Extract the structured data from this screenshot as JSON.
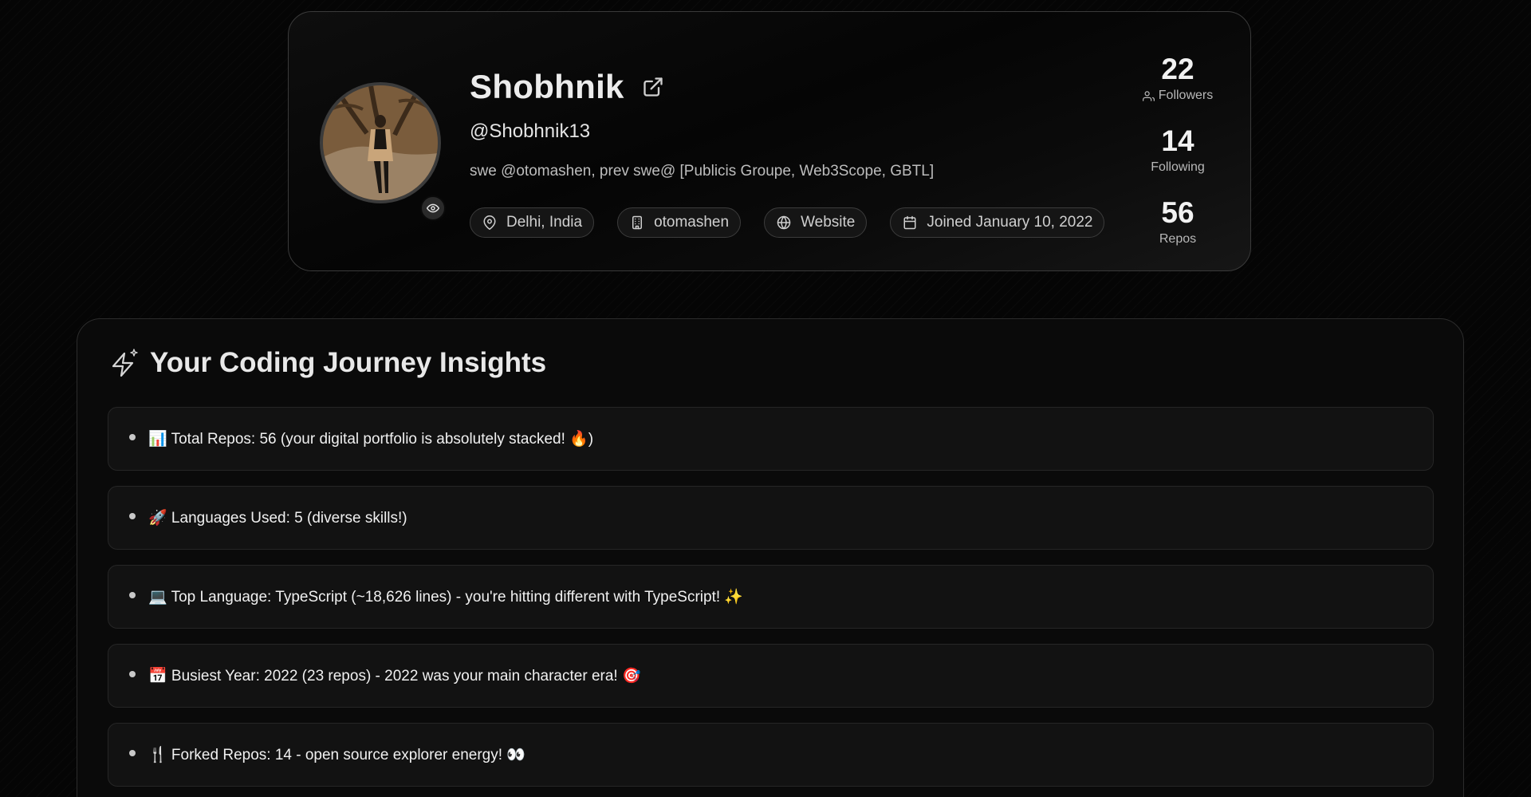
{
  "profile": {
    "name": "Shobhnik",
    "handle": "@Shobhnik13",
    "bio": "swe @otomashen, prev swe@ [Publicis Groupe, Web3Scope, GBTL]",
    "chips": [
      {
        "icon": "map-pin-icon",
        "label": "Delhi, India"
      },
      {
        "icon": "building-icon",
        "label": "otomashen"
      },
      {
        "icon": "globe-icon",
        "label": "Website"
      },
      {
        "icon": "calendar-icon",
        "label": "Joined January 10, 2022"
      }
    ],
    "stats": {
      "followers": {
        "value": "22",
        "label": "Followers"
      },
      "following": {
        "value": "14",
        "label": "Following"
      },
      "repos": {
        "value": "56",
        "label": "Repos"
      }
    }
  },
  "insights": {
    "title": "Your Coding Journey Insights",
    "items": [
      "📊 Total Repos: 56 (your digital portfolio is absolutely stacked! 🔥)",
      "🚀 Languages Used: 5 (diverse skills!)",
      "💻 Top Language: TypeScript (~18,626 lines) - you're hitting different with TypeScript! ✨",
      "📅 Busiest Year: 2022 (23 repos) - 2022 was your main character era! 🎯",
      "🍴 Forked Repos: 14 - open source explorer energy! 👀"
    ]
  },
  "colors": {
    "background": "#050505",
    "card_border": "#3a3a3a",
    "text_primary": "#f0f0f0",
    "text_muted": "#b8b8b8"
  }
}
